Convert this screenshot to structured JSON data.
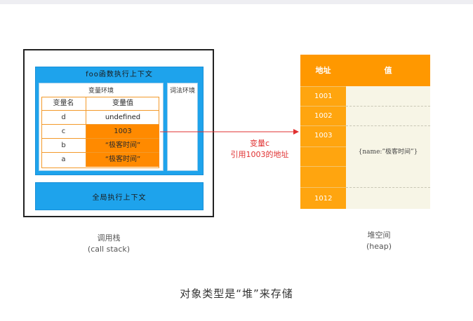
{
  "call_stack": {
    "foo_context_title": "foo函数执行上下文",
    "variable_env_title": "变量环境",
    "lexical_env_title": "词法环境",
    "table_headers": [
      "变量名",
      "变量值"
    ],
    "rows": [
      {
        "name": "d",
        "value": "undefined"
      },
      {
        "name": "c",
        "value": "1003"
      },
      {
        "name": "b",
        "value": "“极客时间”"
      },
      {
        "name": "a",
        "value": "“极客时间”"
      }
    ],
    "global_context_title": "全局执行上下文",
    "label": "调用栈",
    "label_en": "(call stack)"
  },
  "heap": {
    "headers": [
      "地址",
      "值"
    ],
    "addresses": [
      "1001",
      "1002",
      "1003",
      "",
      "1012"
    ],
    "object_value": "{name:”极客时间”}",
    "label": "堆空间",
    "label_en": "(heap)"
  },
  "annotation": {
    "line1": "变量c",
    "line2": "引用1003的地址"
  },
  "caption": "对象类型是“堆”来存储",
  "colors": {
    "context_blue": "#1ea3ec",
    "heap_orange": "#ff9800",
    "highlight_orange": "#ff8a00",
    "arrow_red": "#e03030"
  }
}
